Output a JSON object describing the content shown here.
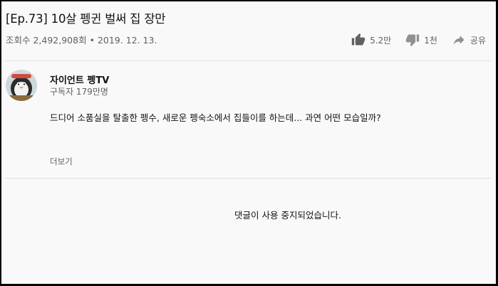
{
  "video": {
    "title": "[Ep.73] 10살 펭귄 벌써 집 장만",
    "views": "조회수 2,492,908회",
    "separator": "•",
    "date": "2019. 12. 13."
  },
  "actions": {
    "like_count": "5.2만",
    "dislike_count": "1천",
    "share_label": "공유"
  },
  "channel": {
    "name": "자이언트 펭TV",
    "subscribers": "구독자 179만명"
  },
  "description": {
    "text": "드디어 소품실을 탈출한 펭수, 새로운 펭숙소에서 집들이를 하는데... 과연 어떤 모습일까?",
    "more_label": "더보기"
  },
  "comments": {
    "disabled_message": "댓글이 사용 중지되었습니다."
  }
}
